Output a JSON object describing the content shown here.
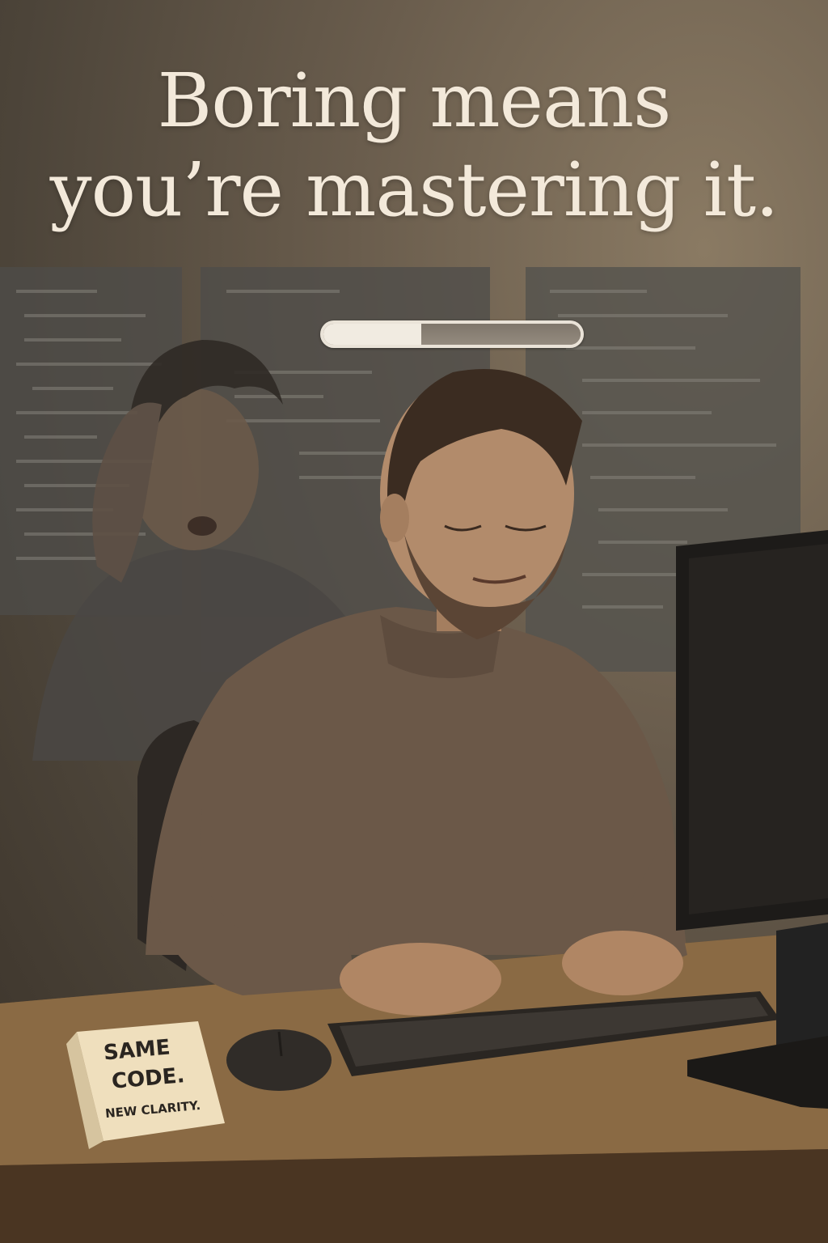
{
  "poster": {
    "headline_line1": "Boring means",
    "headline_line2": "you’re mastering it."
  },
  "progress": {
    "value": 0.38
  },
  "desk_sign": {
    "line1": "SAME",
    "line2": "CODE.",
    "line3": "NEW CLARITY."
  },
  "colors": {
    "headline": "#f3e9da",
    "background": "#5a4f42",
    "desk": "#8a6a44",
    "sweater": "#6b5848"
  }
}
